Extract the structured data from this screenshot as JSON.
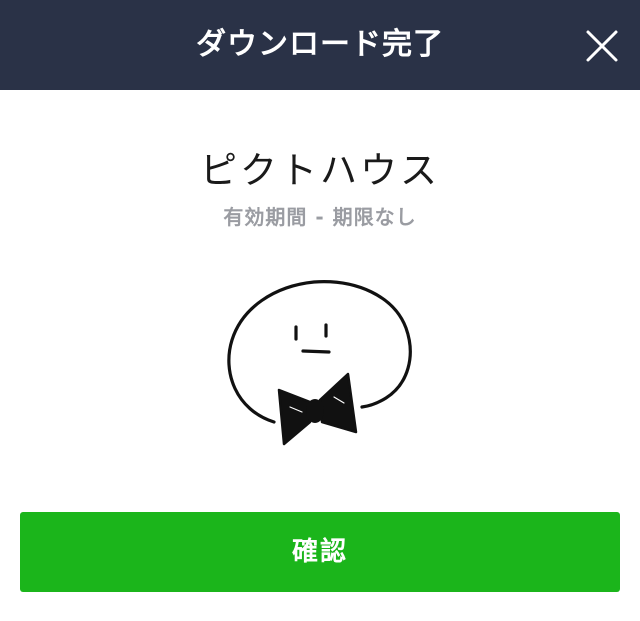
{
  "header": {
    "title": "ダウンロード完了",
    "close_icon": "close-icon",
    "background_color": "#2a3247"
  },
  "product": {
    "name": "ピクトハウス",
    "validity": "有効期間 - 期限なし"
  },
  "sticker": {
    "icon": "bowtie-character-sticker"
  },
  "actions": {
    "confirm_label": "確認",
    "confirm_color": "#1bb51b"
  }
}
